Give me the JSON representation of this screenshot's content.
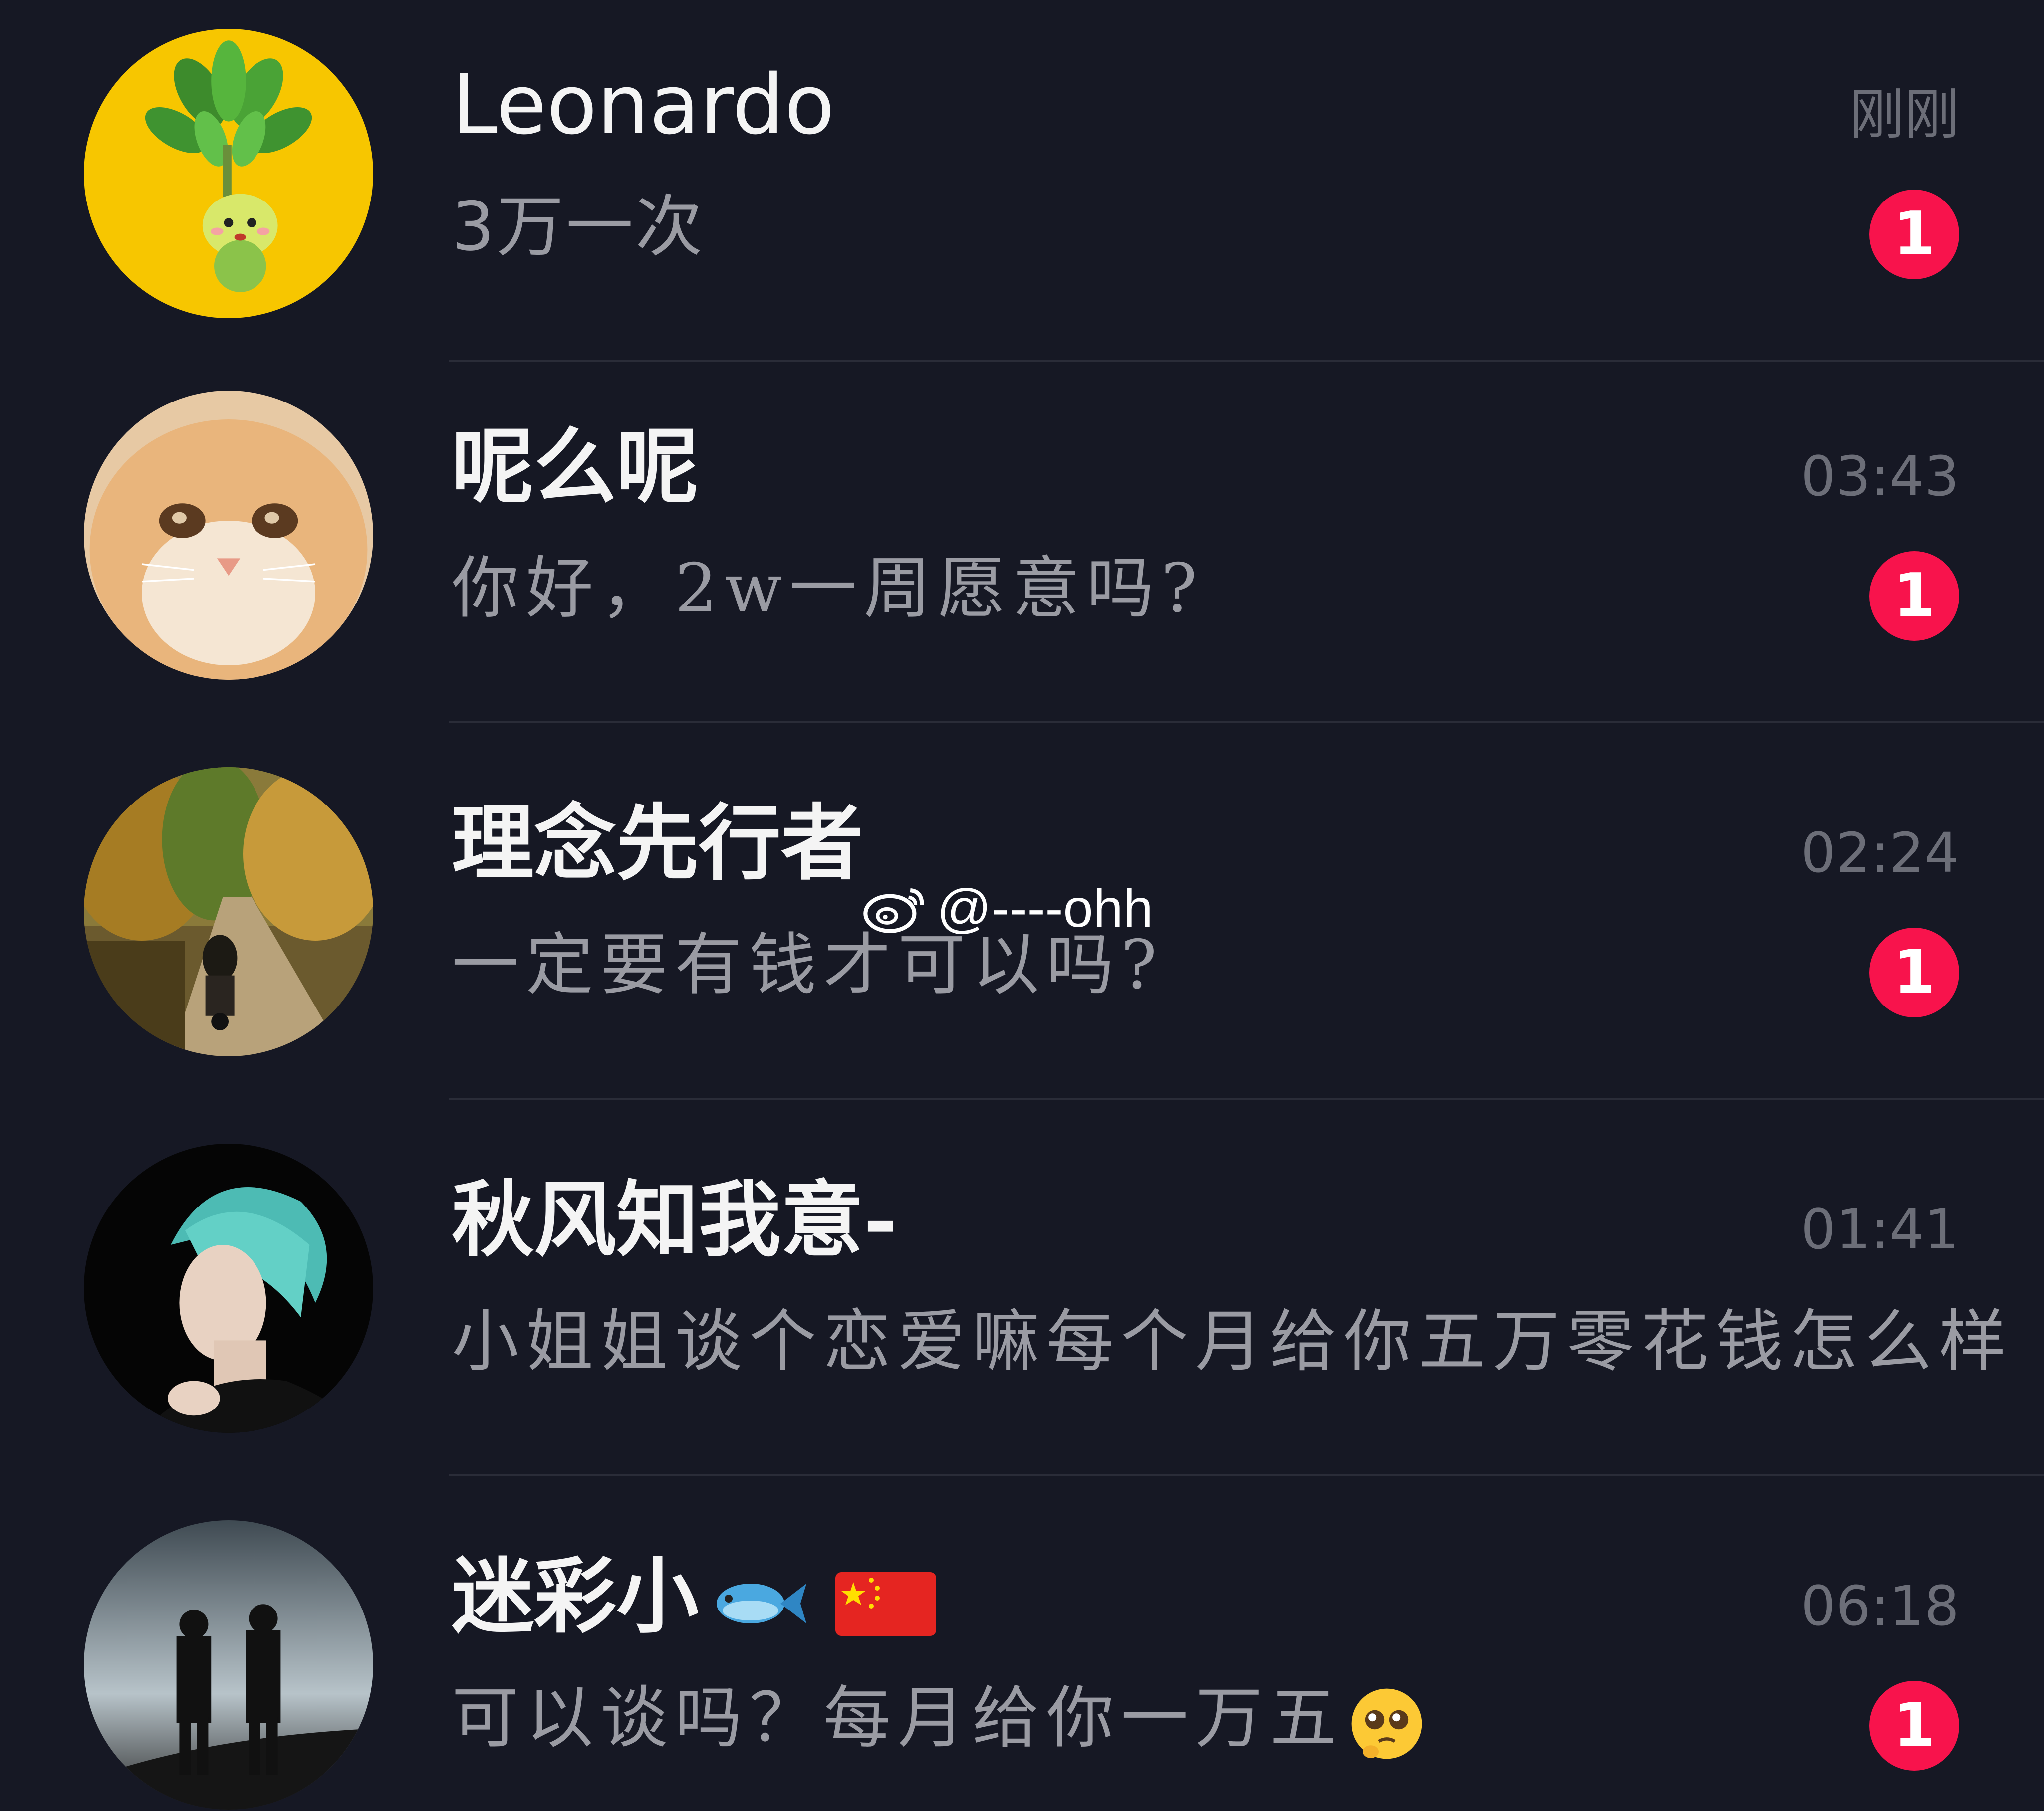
{
  "conversations": [
    {
      "name": "Leonardo",
      "preview": "3万一次",
      "time": "刚刚",
      "unread": "1",
      "avatar": "plant-mascot-avatar"
    },
    {
      "name": "呢么呢",
      "preview": "你好，2w一周愿意吗?",
      "time": "03:43",
      "unread": "1",
      "avatar": "cat-avatar"
    },
    {
      "name": "理念先行者",
      "preview": "一定要有钱才可以吗?",
      "time": "02:24",
      "unread": "1",
      "avatar": "motorcycle-road-avatar"
    },
    {
      "name": "秋风知我意-",
      "preview": "小姐姐谈个恋爱嘛每个月给你五万零花钱怎么样",
      "time": "01:41",
      "unread": "",
      "avatar": "man-portrait-avatar"
    },
    {
      "name": "迷彩小",
      "name_emojis": [
        "fish-emoji",
        "china-flag-emoji"
      ],
      "preview": "可以谈吗？每月给你一万五",
      "preview_emoji": "pleading-face-emoji",
      "time": "06:18",
      "unread": "1",
      "avatar": "silhouette-couple-avatar"
    }
  ],
  "watermark": {
    "icon": "weibo-icon",
    "text": "@----ohh"
  },
  "colors": {
    "background": "#161824",
    "badge": "#f8134c",
    "name": "#f4f4f4",
    "preview": "#9a9ba3",
    "time": "#6c6e78"
  }
}
